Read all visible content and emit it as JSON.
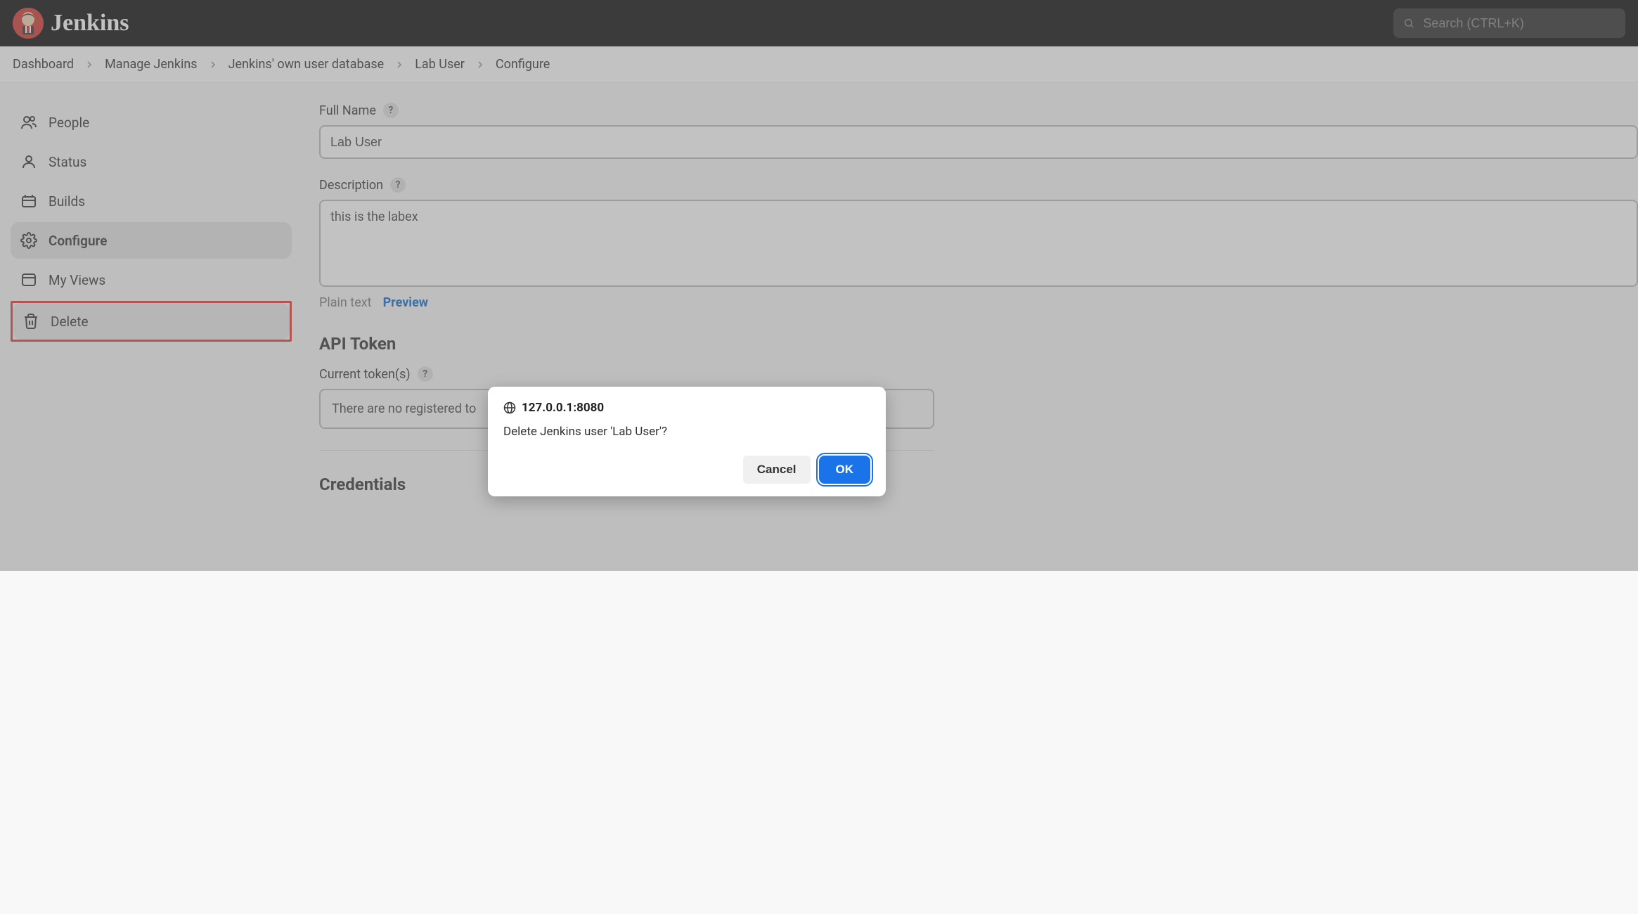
{
  "header": {
    "brand": "Jenkins",
    "search_placeholder": "Search (CTRL+K)"
  },
  "breadcrumb": [
    "Dashboard",
    "Manage Jenkins",
    "Jenkins' own user database",
    "Lab User",
    "Configure"
  ],
  "sidebar": {
    "items": [
      {
        "label": "People"
      },
      {
        "label": "Status"
      },
      {
        "label": "Builds"
      },
      {
        "label": "Configure"
      },
      {
        "label": "My Views"
      },
      {
        "label": "Delete"
      }
    ]
  },
  "main": {
    "fullname_label": "Full Name",
    "fullname_value": "Lab User",
    "description_label": "Description",
    "description_value": "this is the labex",
    "plain_text_label": "Plain text",
    "preview_label": "Preview",
    "api_token_heading": "API Token",
    "current_tokens_label": "Current token(s)",
    "no_tokens_text": "There are no registered to",
    "credentials_heading": "Credentials"
  },
  "dialog": {
    "origin": "127.0.0.1:8080",
    "message": "Delete Jenkins user 'Lab User'?",
    "cancel": "Cancel",
    "ok": "OK"
  }
}
